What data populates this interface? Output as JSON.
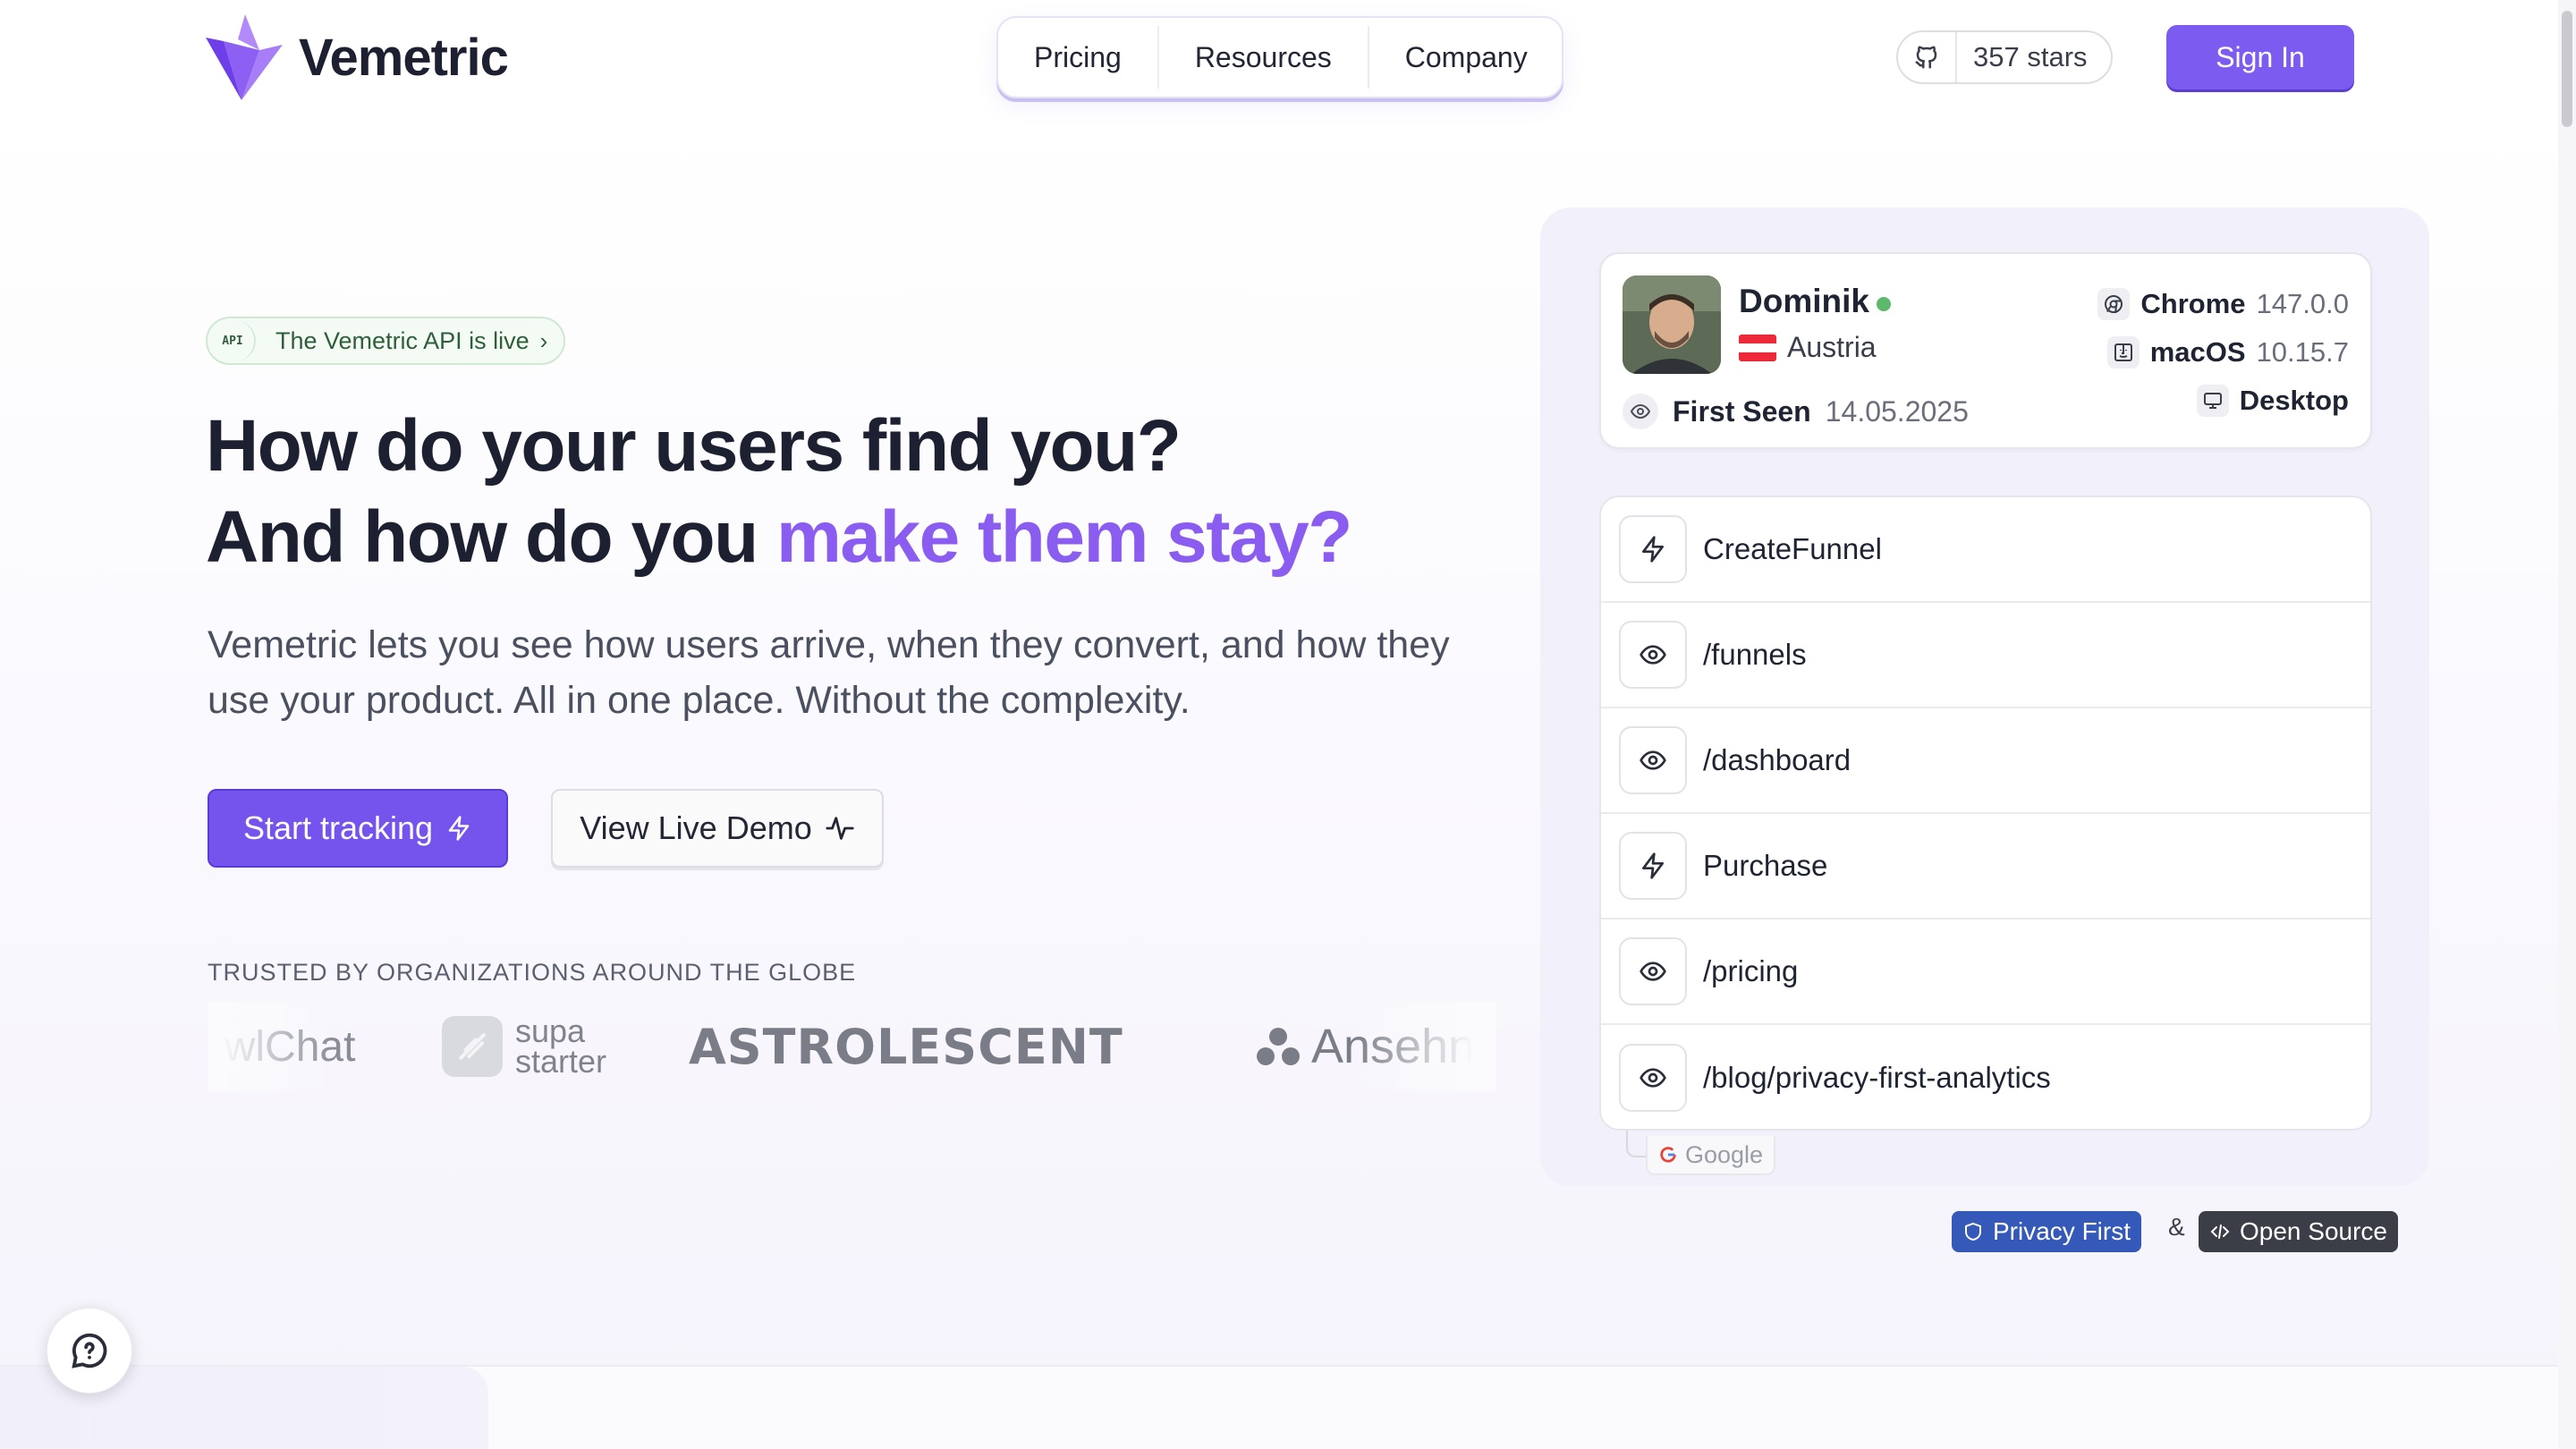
{
  "brand": {
    "name": "Vemetric",
    "accent": "#7c5cf0"
  },
  "nav": {
    "items": [
      "Pricing",
      "Resources",
      "Company"
    ]
  },
  "header": {
    "stars": "357 stars",
    "signin": "Sign In"
  },
  "hero": {
    "badge_tag": "API",
    "badge_text": "The Vemetric API is live",
    "headline_line1": "How do your users find you?",
    "headline_line2_plain": "And how do you ",
    "headline_line2_accent": "make them stay?",
    "subtext": "Vemetric lets you see how users arrive, when they convert, and how they use your product. All in one place. Without the complexity.",
    "cta_primary": "Start tracking",
    "cta_secondary": "View Live Demo",
    "trusted_label": "TRUSTED BY ORGANIZATIONS AROUND THE GLOBE",
    "logos": {
      "first": "awlChat",
      "supa_top": "supa",
      "supa_bottom": "starter",
      "astro": "ASTROLESCENT",
      "anseh": "Ansehn"
    }
  },
  "user_card": {
    "name": "Dominik",
    "country": "Austria",
    "first_seen_label": "First Seen",
    "first_seen_value": "14.05.2025",
    "browser_name": "Chrome",
    "browser_version": "147.0.0",
    "os_name": "macOS",
    "os_version": "10.15.7",
    "device": "Desktop"
  },
  "events": [
    {
      "label": "CreateFunnel",
      "icon": "bolt-icon"
    },
    {
      "label": "/funnels",
      "icon": "eye-icon"
    },
    {
      "label": "/dashboard",
      "icon": "eye-icon"
    },
    {
      "label": "Purchase",
      "icon": "bolt-icon"
    },
    {
      "label": "/pricing",
      "icon": "eye-icon"
    },
    {
      "label": "/blog/privacy-first-analytics",
      "icon": "eye-icon"
    }
  ],
  "referrer": "Google",
  "footer_badges": {
    "privacy": "Privacy First",
    "amp": "&",
    "oss": "Open Source"
  }
}
